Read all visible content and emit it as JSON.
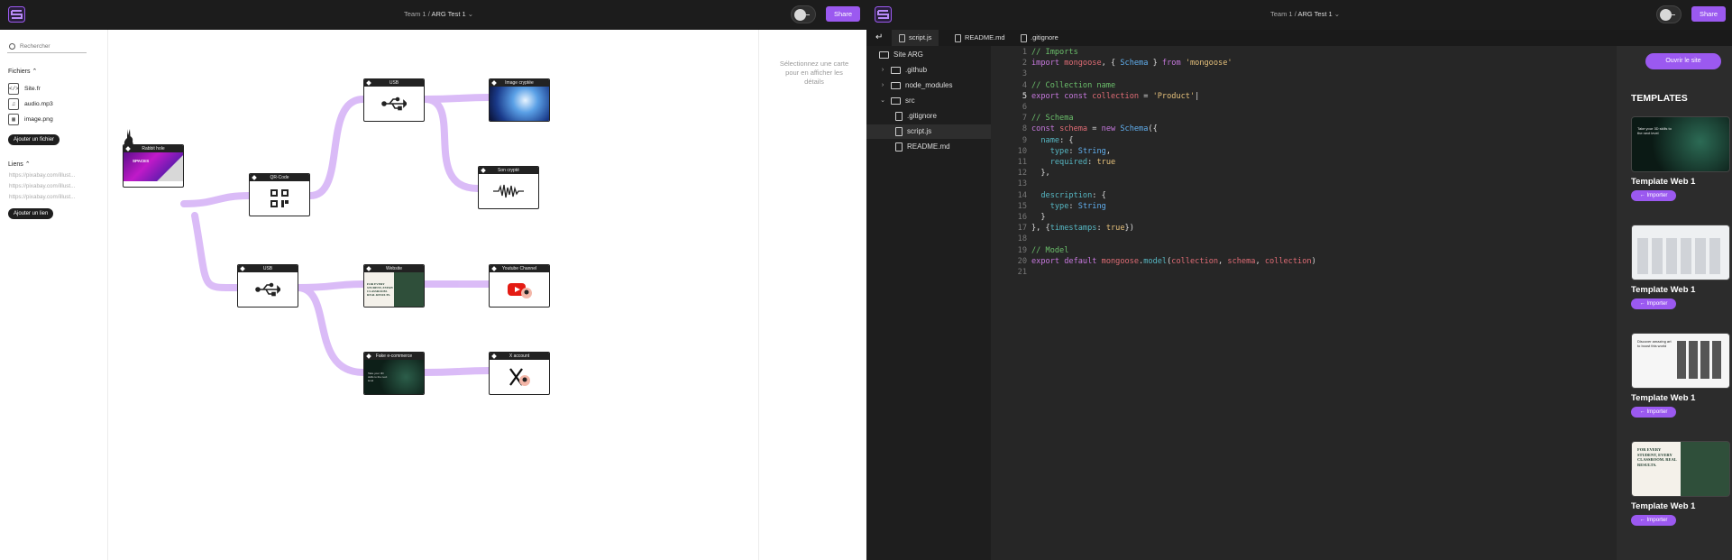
{
  "left_app": {
    "header": {
      "team": "Team 1",
      "separator": "/",
      "project": "ARG Test 1",
      "share_label": "Share"
    },
    "sidebar": {
      "search_placeholder": "Rechercher",
      "files_title": "Fichiers",
      "files": [
        {
          "name": "Site.fr",
          "icon": "code-file-icon"
        },
        {
          "name": "audio.mp3",
          "icon": "audio-file-icon"
        },
        {
          "name": "image.png",
          "icon": "image-file-icon"
        }
      ],
      "add_file_label": "Ajouter un fichier",
      "links_title": "Liens",
      "links": [
        "https://pixabay.com/illust...",
        "https://pixabay.com/illust...",
        "https://pixabay.com/illust..."
      ],
      "add_link_label": "Ajouter un lien"
    },
    "details_hint": "Sélectionnez une carte pour en afficher les détails",
    "nodes": {
      "rabbit": "Rabbit hole",
      "rabbit_text": "SPACES",
      "qr": "QR-Code",
      "usb1": "USB",
      "image": "Image cryptée",
      "son": "Son crypté",
      "usb2": "USB",
      "website": "Website",
      "website_text": "FOR EVERY STUDENT, EVERY CLASSROOM. REAL RESULTS.",
      "youtube": "Youtube Channel",
      "ecommerce": "Fake e-commerce",
      "ecommerce_text": "Take your 3D skills to the next level",
      "x": "X account"
    }
  },
  "right_app": {
    "header": {
      "team": "Team 1",
      "separator": "/",
      "project": "ARG Test 1",
      "share_label": "Share"
    },
    "tabs": [
      "script.js",
      "README.md",
      ".gitignore"
    ],
    "tree": {
      "root": "Site ARG",
      "items": [
        {
          "name": ".github",
          "type": "folder"
        },
        {
          "name": "node_modules",
          "type": "folder"
        },
        {
          "name": "src",
          "type": "folder"
        },
        {
          "name": ".gitignore",
          "type": "file"
        },
        {
          "name": "script.js",
          "type": "file"
        },
        {
          "name": "README.md",
          "type": "file"
        }
      ]
    },
    "code_lines": [
      "// Imports",
      "import mongoose, { Schema } from 'mongoose'",
      "",
      "// Collection name",
      "export const collection = 'Product'|",
      "",
      "// Schema",
      "const schema = new Schema({",
      "  name: {",
      "    type: String,",
      "    required: true",
      "  },",
      "",
      "  description: {",
      "    type: String",
      "  }",
      "}, {timestamps: true})",
      "",
      "// Model",
      "export default mongoose.model(collection, schema, collection)",
      ""
    ],
    "line_numbers": [
      "1",
      "2",
      "3",
      "4",
      "5",
      "6",
      "7",
      "8",
      "9",
      "10",
      "11",
      "12",
      "13",
      "14",
      "15",
      "16",
      "17",
      "18",
      "19",
      "20",
      "21"
    ],
    "templates": {
      "open_site_label": "Ouvrir le site",
      "title": "TEMPLATES",
      "items": [
        {
          "name": "Template Web 1",
          "button": "Importer"
        },
        {
          "name": "Template Web 1",
          "button": "Importer"
        },
        {
          "name": "Template Web 1",
          "button": "Importer"
        },
        {
          "name": "Template Web 1",
          "button": "Importer"
        }
      ],
      "thumb_texts": [
        "Take your 3D skills to the next level",
        "Discover amazing art to boost this world",
        "FOR EVERY STUDENT, EVERY CLASSROOM. REAL RESULTS."
      ]
    }
  },
  "colors": {
    "accent": "#9b59f0",
    "connector": "#d6b3f5",
    "dark": "#1c1c1c"
  }
}
